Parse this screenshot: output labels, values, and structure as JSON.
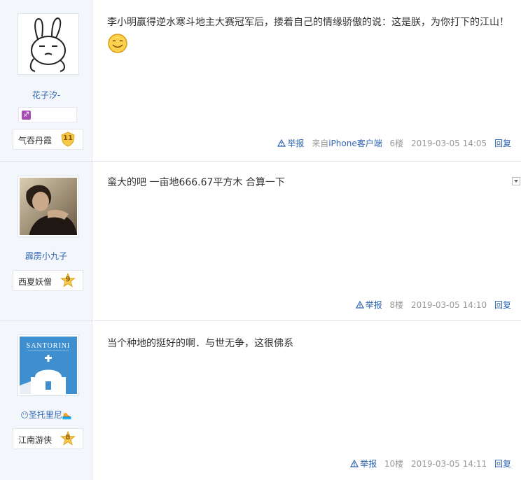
{
  "posts": [
    {
      "username": "花子汐-",
      "gender_icon": "♐",
      "rank_name": "气吞丹霞",
      "rank_level": "11",
      "content_text": "李小明赢得逆水寒斗地主大赛冠军后，搂着自己的情缘骄傲的说：这是朕，为你打下的江山！",
      "emoji": "smiley-face-icon",
      "report_label": "举报",
      "from_label": "来自",
      "from_device": "iPhone客户端",
      "floor": "6楼",
      "datetime": "2019-03-05 14:05",
      "reply_label": "回复"
    },
    {
      "username": "霹雳小九子",
      "rank_name": "西夏妖僧",
      "rank_level": "9",
      "content_text": "蛮大的吧 一亩地666.67平方木 合算一下",
      "report_label": "举报",
      "floor": "8楼",
      "datetime": "2019-03-05 14:10",
      "reply_label": "回复"
    },
    {
      "username": "圣托里尼",
      "username_prefix_emoji": "😶",
      "username_suffix_emoji": "🏊",
      "rank_name": "江南游侠",
      "rank_level": "8",
      "avatar_text": "SANTORINI",
      "content_text": "当个种地的挺好的啊．与世无争，这很佛系",
      "report_label": "举报",
      "floor": "10楼",
      "datetime": "2019-03-05 14:11",
      "reply_label": "回复"
    }
  ],
  "colors": {
    "link_blue": "#2d64b3",
    "sidebar_bg": "#f3f6fa",
    "badge_gold": "#f7c948"
  }
}
